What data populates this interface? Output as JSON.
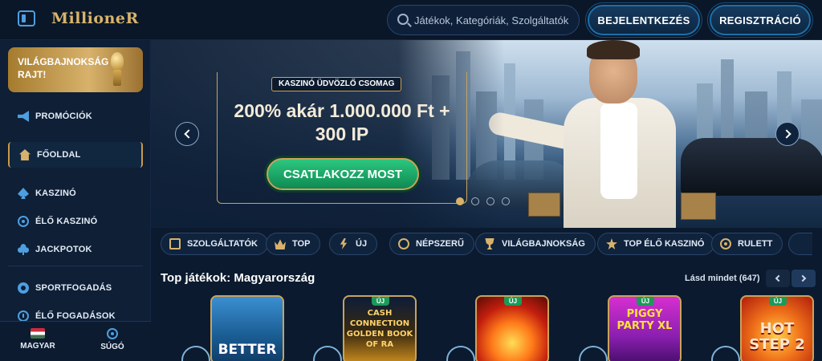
{
  "header": {
    "logo": "MillioneR",
    "search_placeholder": "Játékok, Kategóriák, Szolgáltatók",
    "login_label": "BEJELENTKEZÉS",
    "register_label": "REGISZTRÁCIÓ"
  },
  "sidebar": {
    "banner_label": "VILÁGBAJNOKSÁG RAJT!",
    "items": [
      {
        "label": "PROMÓCIÓK",
        "icon": "megaphone-icon"
      },
      {
        "label": "FŐOLDAL",
        "icon": "home-icon",
        "active": true
      },
      {
        "label": "KASZINÓ",
        "icon": "spade-icon"
      },
      {
        "label": "ÉLŐ KASZINÓ",
        "icon": "chip-icon"
      },
      {
        "label": "JACKPOTOK",
        "icon": "clover-icon"
      },
      {
        "label": "SPORTFOGADÁS",
        "icon": "ball-icon"
      },
      {
        "label": "ÉLŐ FOGADÁSOK",
        "icon": "clock-icon"
      }
    ],
    "footer": {
      "language_label": "MAGYAR",
      "help_label": "SÚGÓ"
    }
  },
  "hero": {
    "badge": "KASZINÓ ÜDVÖZLŐ CSOMAG",
    "title": "200% akár 1.000.000 Ft + 300 IP",
    "cta_label": "CSATLAKOZZ MOST",
    "slide_count": 4,
    "active_slide": 1
  },
  "categories": [
    {
      "label": "SZOLGÁLTATÓK",
      "icon": "book-icon"
    },
    {
      "label": "TOP",
      "icon": "crown-icon"
    },
    {
      "label": "ÚJ",
      "icon": "bolt-icon"
    },
    {
      "label": "NÉPSZERŰ",
      "icon": "medal-icon"
    },
    {
      "label": "VILÁGBAJNOKSÁG",
      "icon": "trophy-icon"
    },
    {
      "label": "TOP ÉLŐ KASZINÓ",
      "icon": "star-icon"
    },
    {
      "label": "RULETT",
      "icon": "roulette-icon"
    }
  ],
  "top_games": {
    "title": "Top játékok: Magyarország",
    "see_all": "Lásd mindet (647)",
    "games": [
      {
        "title": "BETTER",
        "new": false
      },
      {
        "title": "CASH CONNECTION GOLDEN BOOK OF RA",
        "new": true,
        "badge": "ÚJ"
      },
      {
        "title": "",
        "new": true,
        "badge": "ÚJ"
      },
      {
        "title": "PIGGY PARTY XL",
        "new": true,
        "badge": "ÚJ"
      },
      {
        "title": "HOT STEP 2",
        "new": true,
        "badge": "ÚJ"
      }
    ]
  },
  "colors": {
    "background": "#0b1a2e",
    "gold": "#d8b26b",
    "accent_blue": "#4d9fe0",
    "cta_green": "#1fae6a"
  }
}
